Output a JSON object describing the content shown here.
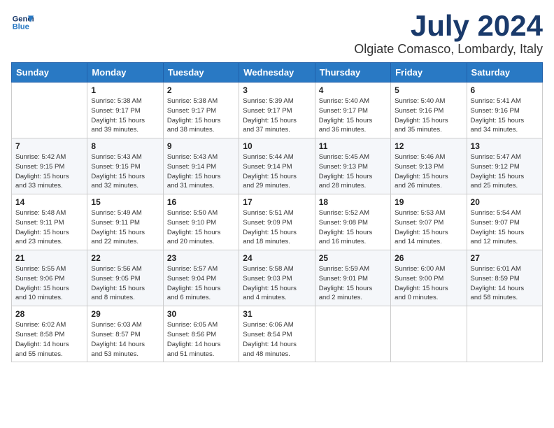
{
  "logo": {
    "line1": "General",
    "line2": "Blue"
  },
  "title": "July 2024",
  "location": "Olgiate Comasco, Lombardy, Italy",
  "weekdays": [
    "Sunday",
    "Monday",
    "Tuesday",
    "Wednesday",
    "Thursday",
    "Friday",
    "Saturday"
  ],
  "weeks": [
    [
      {
        "day": "",
        "info": ""
      },
      {
        "day": "1",
        "info": "Sunrise: 5:38 AM\nSunset: 9:17 PM\nDaylight: 15 hours\nand 39 minutes."
      },
      {
        "day": "2",
        "info": "Sunrise: 5:38 AM\nSunset: 9:17 PM\nDaylight: 15 hours\nand 38 minutes."
      },
      {
        "day": "3",
        "info": "Sunrise: 5:39 AM\nSunset: 9:17 PM\nDaylight: 15 hours\nand 37 minutes."
      },
      {
        "day": "4",
        "info": "Sunrise: 5:40 AM\nSunset: 9:17 PM\nDaylight: 15 hours\nand 36 minutes."
      },
      {
        "day": "5",
        "info": "Sunrise: 5:40 AM\nSunset: 9:16 PM\nDaylight: 15 hours\nand 35 minutes."
      },
      {
        "day": "6",
        "info": "Sunrise: 5:41 AM\nSunset: 9:16 PM\nDaylight: 15 hours\nand 34 minutes."
      }
    ],
    [
      {
        "day": "7",
        "info": "Sunrise: 5:42 AM\nSunset: 9:15 PM\nDaylight: 15 hours\nand 33 minutes."
      },
      {
        "day": "8",
        "info": "Sunrise: 5:43 AM\nSunset: 9:15 PM\nDaylight: 15 hours\nand 32 minutes."
      },
      {
        "day": "9",
        "info": "Sunrise: 5:43 AM\nSunset: 9:14 PM\nDaylight: 15 hours\nand 31 minutes."
      },
      {
        "day": "10",
        "info": "Sunrise: 5:44 AM\nSunset: 9:14 PM\nDaylight: 15 hours\nand 29 minutes."
      },
      {
        "day": "11",
        "info": "Sunrise: 5:45 AM\nSunset: 9:13 PM\nDaylight: 15 hours\nand 28 minutes."
      },
      {
        "day": "12",
        "info": "Sunrise: 5:46 AM\nSunset: 9:13 PM\nDaylight: 15 hours\nand 26 minutes."
      },
      {
        "day": "13",
        "info": "Sunrise: 5:47 AM\nSunset: 9:12 PM\nDaylight: 15 hours\nand 25 minutes."
      }
    ],
    [
      {
        "day": "14",
        "info": "Sunrise: 5:48 AM\nSunset: 9:11 PM\nDaylight: 15 hours\nand 23 minutes."
      },
      {
        "day": "15",
        "info": "Sunrise: 5:49 AM\nSunset: 9:11 PM\nDaylight: 15 hours\nand 22 minutes."
      },
      {
        "day": "16",
        "info": "Sunrise: 5:50 AM\nSunset: 9:10 PM\nDaylight: 15 hours\nand 20 minutes."
      },
      {
        "day": "17",
        "info": "Sunrise: 5:51 AM\nSunset: 9:09 PM\nDaylight: 15 hours\nand 18 minutes."
      },
      {
        "day": "18",
        "info": "Sunrise: 5:52 AM\nSunset: 9:08 PM\nDaylight: 15 hours\nand 16 minutes."
      },
      {
        "day": "19",
        "info": "Sunrise: 5:53 AM\nSunset: 9:07 PM\nDaylight: 15 hours\nand 14 minutes."
      },
      {
        "day": "20",
        "info": "Sunrise: 5:54 AM\nSunset: 9:07 PM\nDaylight: 15 hours\nand 12 minutes."
      }
    ],
    [
      {
        "day": "21",
        "info": "Sunrise: 5:55 AM\nSunset: 9:06 PM\nDaylight: 15 hours\nand 10 minutes."
      },
      {
        "day": "22",
        "info": "Sunrise: 5:56 AM\nSunset: 9:05 PM\nDaylight: 15 hours\nand 8 minutes."
      },
      {
        "day": "23",
        "info": "Sunrise: 5:57 AM\nSunset: 9:04 PM\nDaylight: 15 hours\nand 6 minutes."
      },
      {
        "day": "24",
        "info": "Sunrise: 5:58 AM\nSunset: 9:03 PM\nDaylight: 15 hours\nand 4 minutes."
      },
      {
        "day": "25",
        "info": "Sunrise: 5:59 AM\nSunset: 9:01 PM\nDaylight: 15 hours\nand 2 minutes."
      },
      {
        "day": "26",
        "info": "Sunrise: 6:00 AM\nSunset: 9:00 PM\nDaylight: 15 hours\nand 0 minutes."
      },
      {
        "day": "27",
        "info": "Sunrise: 6:01 AM\nSunset: 8:59 PM\nDaylight: 14 hours\nand 58 minutes."
      }
    ],
    [
      {
        "day": "28",
        "info": "Sunrise: 6:02 AM\nSunset: 8:58 PM\nDaylight: 14 hours\nand 55 minutes."
      },
      {
        "day": "29",
        "info": "Sunrise: 6:03 AM\nSunset: 8:57 PM\nDaylight: 14 hours\nand 53 minutes."
      },
      {
        "day": "30",
        "info": "Sunrise: 6:05 AM\nSunset: 8:56 PM\nDaylight: 14 hours\nand 51 minutes."
      },
      {
        "day": "31",
        "info": "Sunrise: 6:06 AM\nSunset: 8:54 PM\nDaylight: 14 hours\nand 48 minutes."
      },
      {
        "day": "",
        "info": ""
      },
      {
        "day": "",
        "info": ""
      },
      {
        "day": "",
        "info": ""
      }
    ]
  ]
}
